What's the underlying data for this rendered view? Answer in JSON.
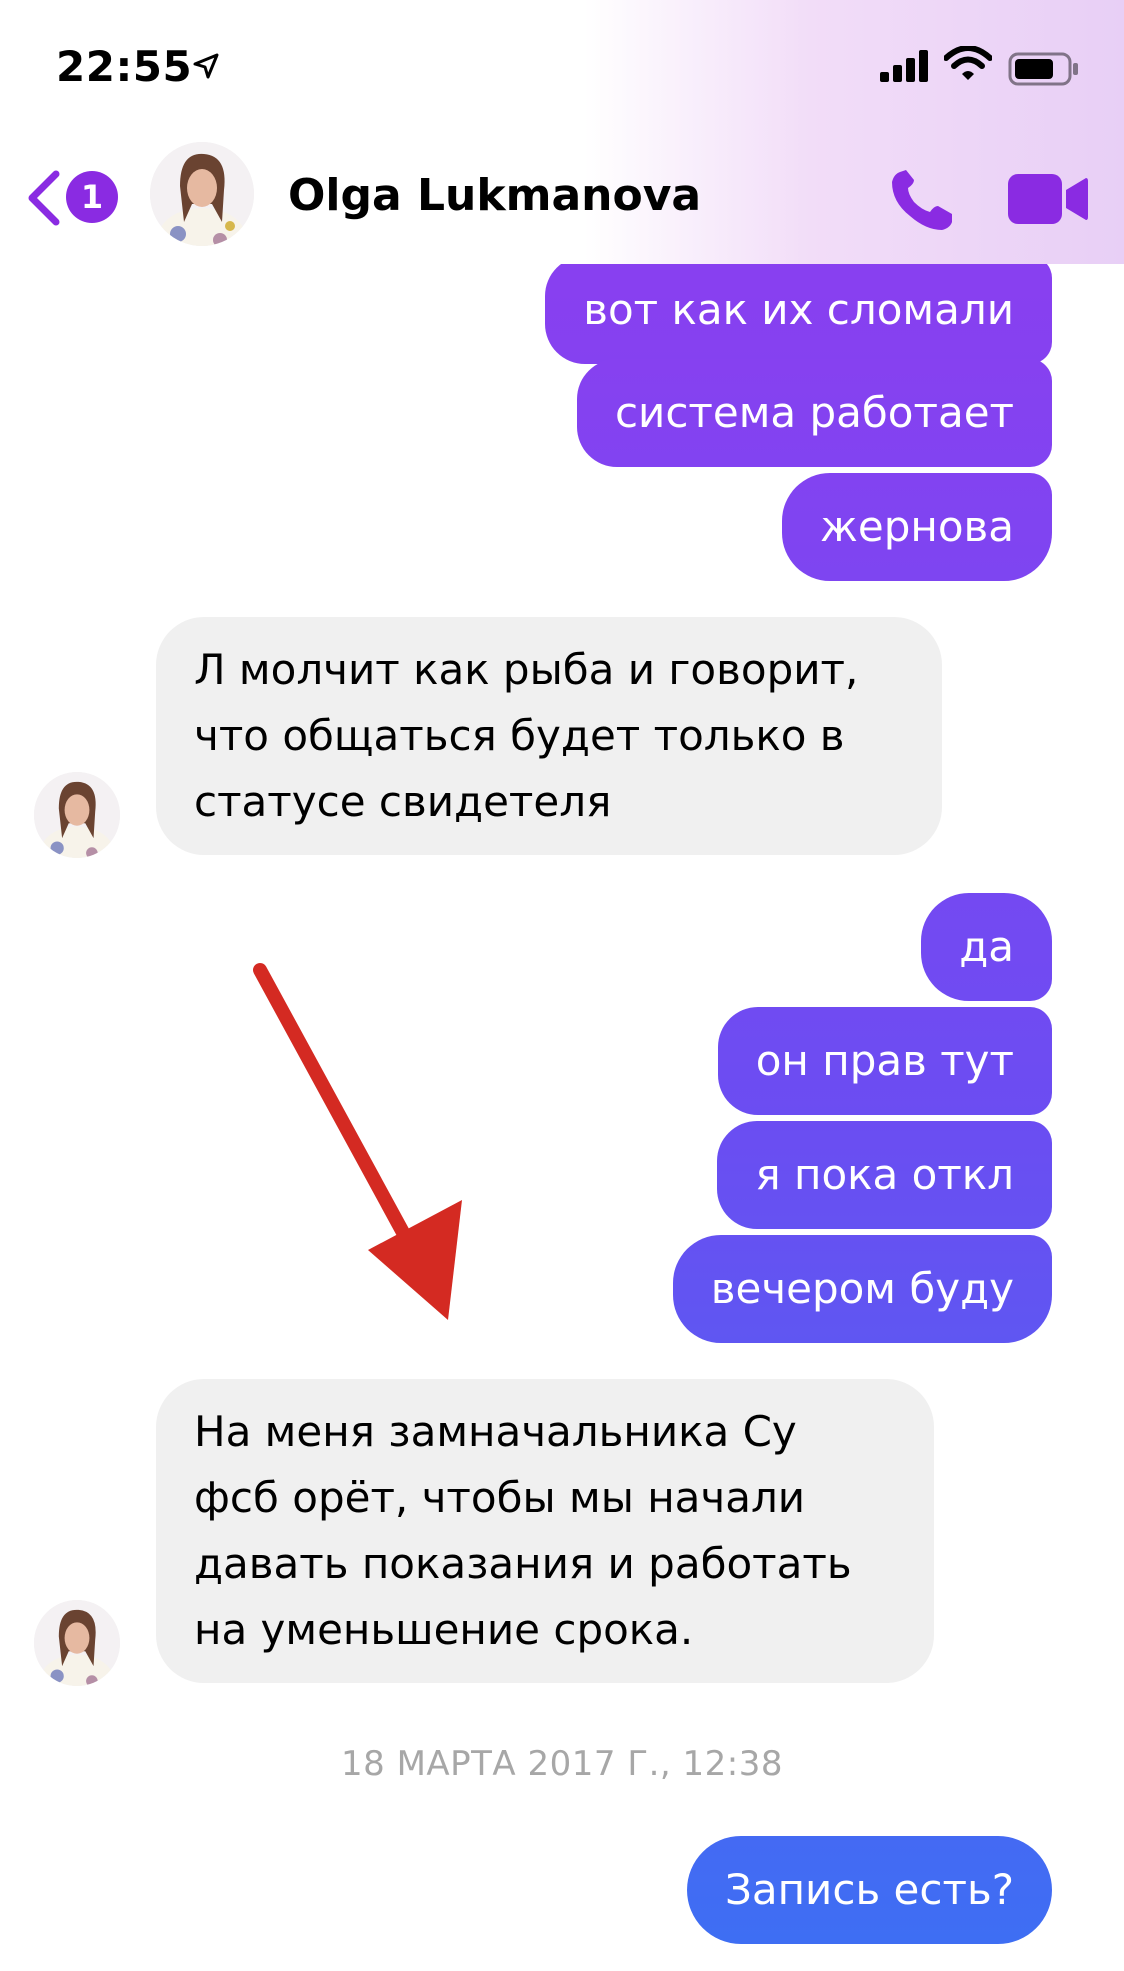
{
  "status_bar": {
    "time": "22:55"
  },
  "header": {
    "back_badge": "1",
    "contact_name": "Olga Lukmanova"
  },
  "messages": [
    {
      "side": "out",
      "text": "вот как их сломали"
    },
    {
      "side": "out",
      "text": "система работает"
    },
    {
      "side": "out",
      "text": "жернова"
    },
    {
      "side": "in",
      "lines": [
        "Л молчит как рыба и говорит,",
        "что общаться будет только в",
        "статусе свидетеля"
      ]
    },
    {
      "side": "out",
      "text": "да"
    },
    {
      "side": "out",
      "text": "он прав тут"
    },
    {
      "side": "out",
      "text": "я пока откл"
    },
    {
      "side": "out",
      "text": "вечером буду"
    },
    {
      "side": "in",
      "lines": [
        "На меня замначальника Су",
        "фсб орёт, чтобы мы начали",
        "давать показания и работать",
        "на уменьшение срока."
      ]
    },
    {
      "side": "out",
      "text": "Запись есть?"
    }
  ],
  "date_separator": "18 МАРТА 2017 Г., 12:38",
  "colors": {
    "accent_purple": "#8a2be2",
    "bubble_top": "#8b3ff0",
    "bubble_mid": "#6d4cf2",
    "bubble_bottom": "#3d6ff3",
    "incoming_bg": "#f0f0f0",
    "annotation_arrow": "#d42a22"
  },
  "icons": [
    "location-arrow-icon",
    "signal-icon",
    "wifi-icon",
    "battery-icon",
    "back-chevron-icon",
    "phone-icon",
    "video-camera-icon",
    "annotation-arrow"
  ]
}
